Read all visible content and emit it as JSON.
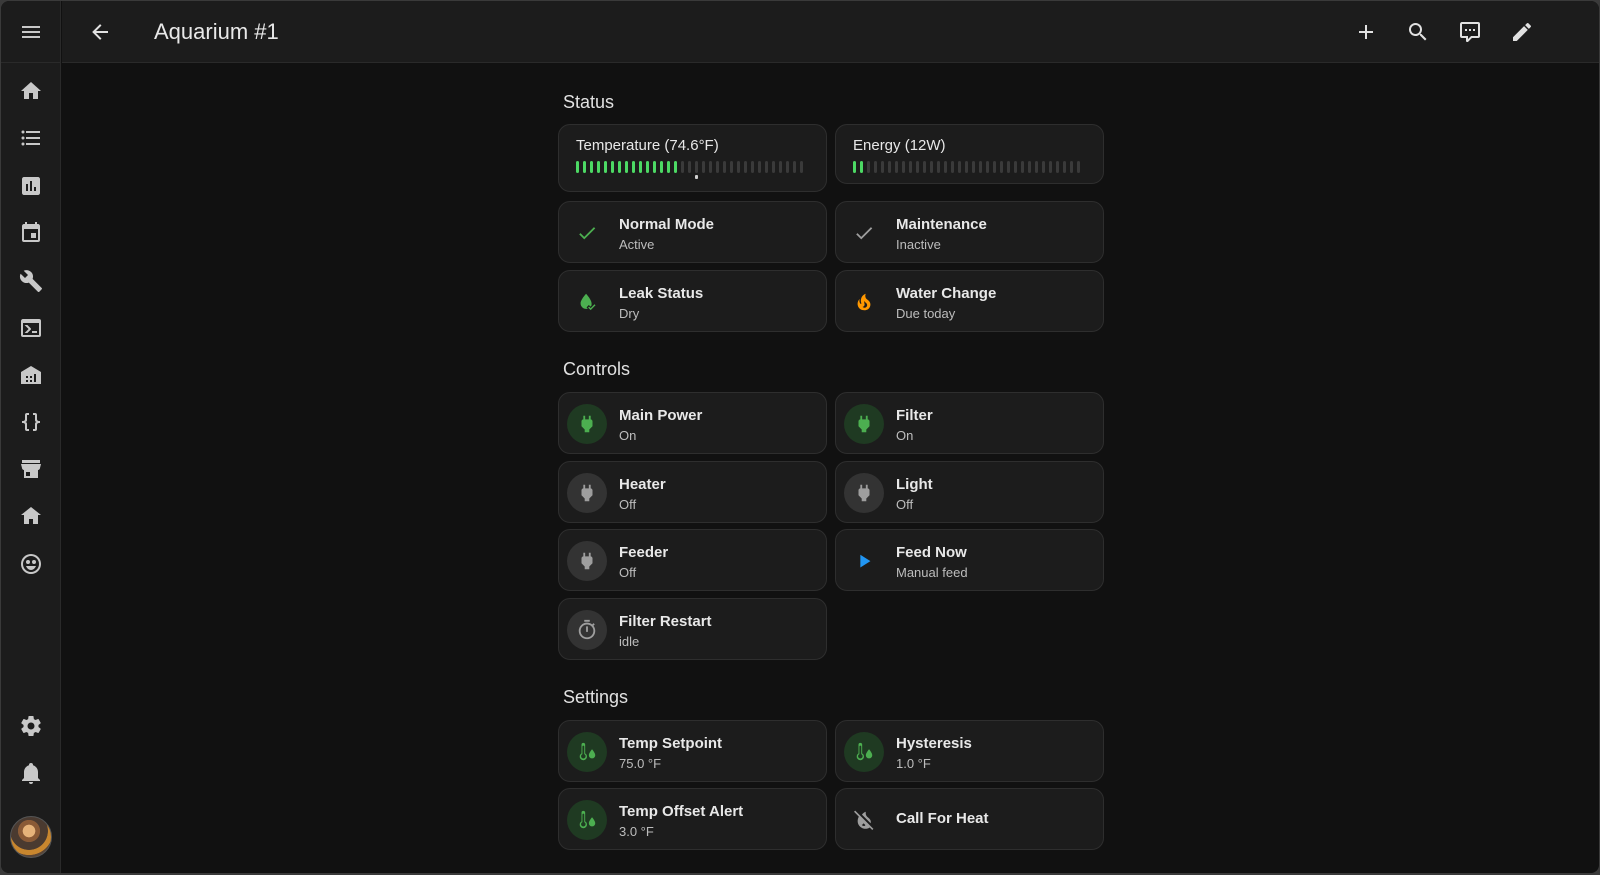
{
  "header": {
    "title": "Aquarium #1",
    "icons": [
      "menu-icon",
      "back-arrow-icon",
      "plus-icon",
      "search-icon",
      "assist-icon",
      "pencil-icon"
    ]
  },
  "sidebar": {
    "items": [
      "home-icon",
      "list-icon",
      "chart-icon",
      "calendar-icon",
      "wrench-icon",
      "terminal-icon",
      "building-icon",
      "code-braces-icon",
      "hacs-icon",
      "house-icon",
      "robot-icon"
    ],
    "bottom": [
      "gear-icon",
      "bell-icon",
      "avatar"
    ]
  },
  "sections": {
    "status": "Status",
    "controls": "Controls",
    "settings": "Settings"
  },
  "status": {
    "temperature": {
      "label": "Temperature (74.6°F)",
      "fill": 0.45,
      "marker": 0.5
    },
    "energy": {
      "label": "Energy (12W)",
      "fill": 0.06
    },
    "normal_mode": {
      "name": "Normal Mode",
      "state": "Active",
      "icon": "check-icon",
      "color": "#4caf50"
    },
    "maintenance": {
      "name": "Maintenance",
      "state": "Inactive",
      "icon": "check-icon",
      "color": "#9e9e9e"
    },
    "leak_status": {
      "name": "Leak Status",
      "state": "Dry",
      "icon": "water-check-icon",
      "color": "#4caf50"
    },
    "water_change": {
      "name": "Water Change",
      "state": "Due today",
      "icon": "fire-icon",
      "color": "#ff9800"
    }
  },
  "controls": {
    "main_power": {
      "name": "Main Power",
      "state": "On"
    },
    "filter": {
      "name": "Filter",
      "state": "On"
    },
    "heater": {
      "name": "Heater",
      "state": "Off"
    },
    "light": {
      "name": "Light",
      "state": "Off"
    },
    "feeder": {
      "name": "Feeder",
      "state": "Off"
    },
    "feed_now": {
      "name": "Feed Now",
      "state": "Manual feed",
      "color": "#2196f3"
    },
    "filter_restart": {
      "name": "Filter Restart",
      "state": "idle"
    }
  },
  "settings": {
    "temp_setpoint": {
      "name": "Temp Setpoint",
      "state": "75.0 °F"
    },
    "hysteresis": {
      "name": "Hysteresis",
      "state": "1.0 °F"
    },
    "temp_offset_alert": {
      "name": "Temp Offset Alert",
      "state": "3.0 °F"
    },
    "call_for_heat": {
      "name": "Call For Heat"
    }
  },
  "colors": {
    "on_green": "#4cd964",
    "accent_green": "#4caf50",
    "surface": "#1c1c1c",
    "background": "#111111"
  }
}
